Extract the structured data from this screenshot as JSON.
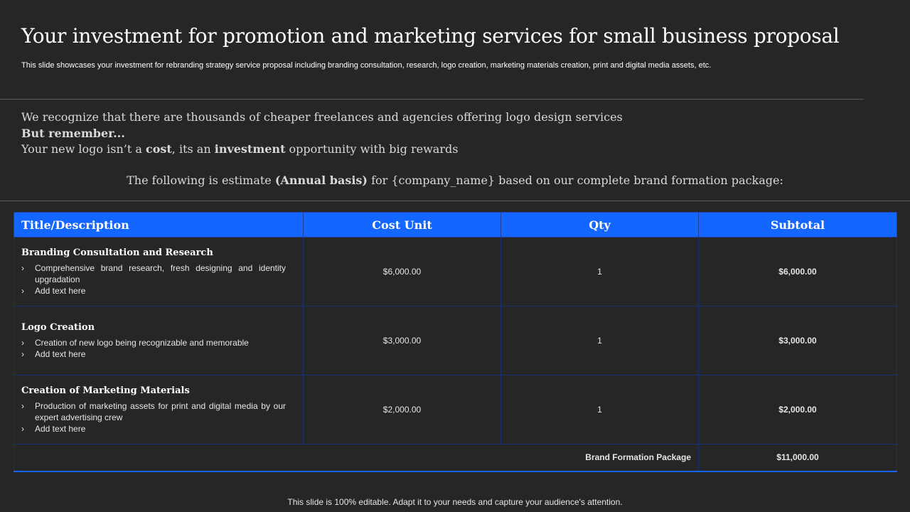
{
  "header": {
    "title": "Your investment  for promotion and marketing  services for small business  proposal",
    "subtitle": "This slide showcases your investment for rebranding strategy service proposal including branding consultation, research, logo creation, marketing materials creation, print and digital media assets, etc."
  },
  "intro": {
    "line1": "We recognize that there are thousands of cheaper freelances and agencies offering logo design services",
    "line2": "But remember...",
    "line3_a": "Your new logo isn’t a ",
    "line3_b": "cost",
    "line3_c": ", its an ",
    "line3_d": "investment",
    "line3_e": " opportunity with big rewards"
  },
  "estimate": {
    "a": "The following is estimate ",
    "b": "(Annual basis)",
    "c": " for {company_name} based on our complete brand formation package:"
  },
  "table": {
    "headers": [
      "Title/Description",
      "Cost Unit",
      "Qty",
      "Subtotal"
    ],
    "bullet_glyph": "›",
    "rows": [
      {
        "title": "Branding Consultation and Research",
        "bullets": [
          "Comprehensive  brand research, fresh designing and identity upgradation",
          "Add text here"
        ],
        "cost": "$6,000.00",
        "qty": "1",
        "subtotal": "$6,000.00"
      },
      {
        "title": "Logo Creation",
        "bullets": [
          "Creation of new logo being recognizable and memorable",
          "Add text here"
        ],
        "cost": "$3,000.00",
        "qty": "1",
        "subtotal": "$3,000.00"
      },
      {
        "title": "Creation of Marketing Materials",
        "bullets": [
          "Production of marketing assets for print and digital media by our expert advertising  crew",
          "Add text here"
        ],
        "cost": "$2,000.00",
        "qty": "1",
        "subtotal": "$2,000.00"
      }
    ],
    "total_label": "Brand Formation Package",
    "total_value": "$11,000.00"
  },
  "footer": "This slide is 100% editable. Adapt it to your needs and capture your audience's attention.",
  "colors": {
    "background": "#262626",
    "header_fill": "#1366ff",
    "border": "#1a2f6e"
  }
}
